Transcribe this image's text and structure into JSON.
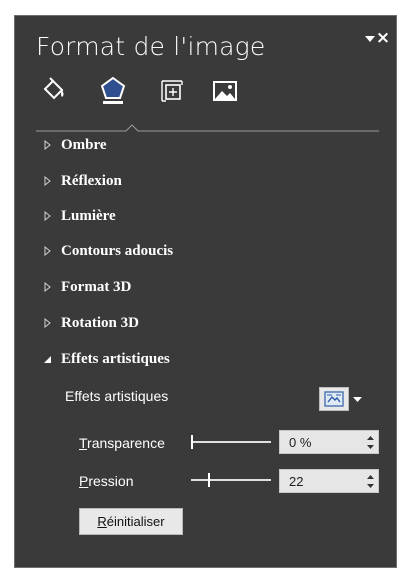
{
  "pane": {
    "title": "Format de l'image",
    "close_symbol": "×"
  },
  "tabs": [
    {
      "icon": "fill-line-icon"
    },
    {
      "icon": "effects-icon",
      "selected": true
    },
    {
      "icon": "size-properties-icon"
    },
    {
      "icon": "picture-icon"
    }
  ],
  "sections": [
    {
      "label": "Ombre",
      "expanded": false
    },
    {
      "label": "Réflexion",
      "expanded": false
    },
    {
      "label": "Lumière",
      "expanded": false
    },
    {
      "label": "Contours adoucis",
      "expanded": false
    },
    {
      "label": "Format 3D",
      "expanded": false
    },
    {
      "label": "Rotation 3D",
      "expanded": false
    },
    {
      "label": "Effets artistiques",
      "expanded": true
    }
  ],
  "artistic": {
    "row_label": "Effets artistiques",
    "transparency": {
      "label_accel": "T",
      "label_rest": "ransparence",
      "value": "0 %",
      "slider_fraction": 0
    },
    "pressure": {
      "label_accel": "P",
      "label_rest": "ression",
      "value": "22",
      "slider_fraction": 0.22
    },
    "reset": {
      "label_accel": "R",
      "label_rest": "éinitialiser"
    }
  },
  "colors": {
    "pane_bg": "#3a3a3a",
    "selected_tab_blue": "#2f4f8f",
    "text": "#ffffff"
  }
}
